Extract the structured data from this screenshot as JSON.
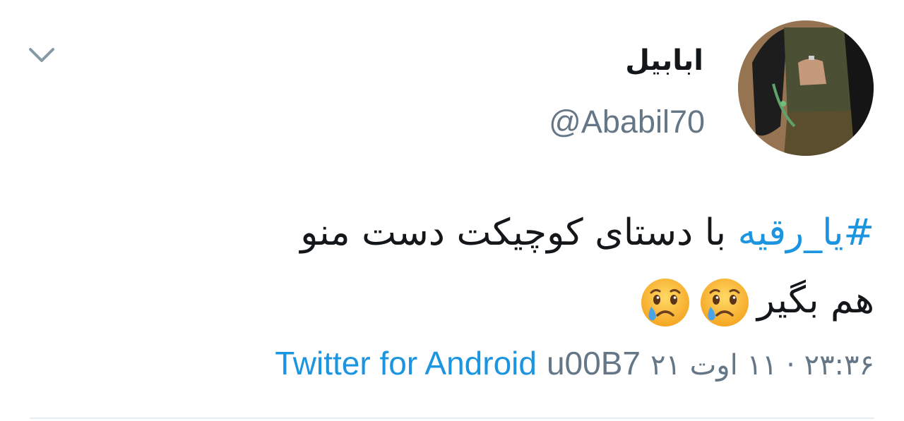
{
  "header": {
    "display_name": "ابابیل",
    "handle": "@Ababil70",
    "avatar_icon": "user-avatar-photo",
    "menu_icon": "chevron-down-icon"
  },
  "tweet": {
    "hashtag": "#یا_رقیه",
    "line1_text": " با دستای کوچیکت دست منو",
    "line2_text": "هم بگیر",
    "emoji_name": "crying-face-emoji",
    "emoji_count": 2
  },
  "meta": {
    "timestamp": "۲۳:۳۶ · ۱۱ اوت ۲۱",
    "separator": "u00B7",
    "source": "Twitter for Android"
  },
  "colors": {
    "link": "#1b95e0",
    "secondary_text": "#657786",
    "primary_text": "#14171a",
    "divider": "#e6ecf0"
  }
}
